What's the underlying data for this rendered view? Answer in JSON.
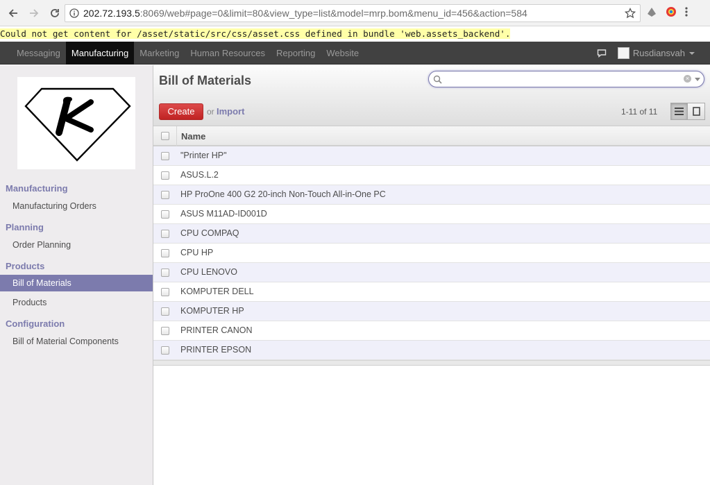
{
  "browser": {
    "url_host": "202.72.193.5",
    "url_rest": ":8069/web#page=0&limit=80&view_type=list&model=mrp.bom&menu_id=456&action=584"
  },
  "warning": "Could not get content for /asset/static/src/css/asset.css defined in bundle 'web.assets_backend'.",
  "topmenu": {
    "items": [
      {
        "label": "Messaging"
      },
      {
        "label": "Manufacturing"
      },
      {
        "label": "Marketing"
      },
      {
        "label": "Human Resources"
      },
      {
        "label": "Reporting"
      },
      {
        "label": "Website"
      }
    ],
    "user": "Rusdiansvah"
  },
  "sidebar": {
    "sections": [
      {
        "title": "Manufacturing",
        "items": [
          "Manufacturing Orders"
        ]
      },
      {
        "title": "Planning",
        "items": [
          "Order Planning"
        ]
      },
      {
        "title": "Products",
        "items": [
          "Bill of Materials",
          "Products"
        ]
      },
      {
        "title": "Configuration",
        "items": [
          "Bill of Material Components"
        ]
      }
    ],
    "active_item": "Bill of Materials"
  },
  "main": {
    "title": "Bill of Materials",
    "create_label": "Create",
    "or_label": "or",
    "import_label": "Import",
    "pager": "1-11 of 11",
    "column_name": "Name",
    "rows": [
      "\"Printer HP\"",
      "ASUS.L.2",
      "HP ProOne 400 G2 20-inch Non-Touch All-in-One PC",
      "ASUS M11AD-ID001D",
      "CPU COMPAQ",
      "CPU HP",
      "CPU LENOVO",
      "KOMPUTER DELL",
      "KOMPUTER HP",
      "PRINTER CANON",
      "PRINTER EPSON"
    ]
  },
  "colors": {
    "accent": "#7c7bad",
    "create": "#dc3a3a",
    "topbar": "#414141"
  }
}
